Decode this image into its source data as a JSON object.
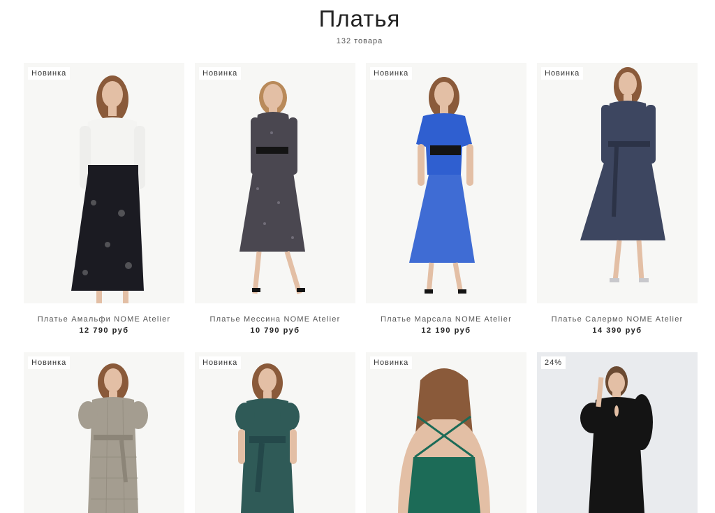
{
  "header": {
    "title": "Платья",
    "count": "132 товара"
  },
  "products": [
    {
      "badge": "Новинка",
      "name": "Платье Амальфи NOME Atelier",
      "price": "12 790 руб",
      "photo": "dress-photo-white-black-lace"
    },
    {
      "badge": "Новинка",
      "name": "Платье Мессина NOME Atelier",
      "price": "10 790 руб",
      "photo": "dress-photo-sequin-black"
    },
    {
      "badge": "Новинка",
      "name": "Платье Марсала NOME Atelier",
      "price": "12 190 руб",
      "photo": "dress-photo-blue-chiffon"
    },
    {
      "badge": "Новинка",
      "name": "Платье Салермо NOME Atelier",
      "price": "14 390 руб",
      "photo": "dress-photo-navy-lurex"
    },
    {
      "badge": "Новинка",
      "photo": "dress-photo-grey-check"
    },
    {
      "badge": "Новинка",
      "photo": "dress-photo-teal-velvet"
    },
    {
      "badge": "Новинка",
      "photo": "dress-photo-green-slip-back"
    },
    {
      "badge": "24%",
      "photo": "dress-photo-black-keyhole"
    }
  ],
  "colors": {
    "white_dress": "#f4f4f2",
    "black_lace": "#1b1b22",
    "sequin": "#4a4750",
    "blue": "#2f5fd0",
    "navy": "#3d4660",
    "grey_check": "#a49d90",
    "teal_velvet": "#2f5a57",
    "green_slip": "#1c6b57",
    "black": "#141414",
    "hair": "#8a5a3a",
    "skin": "#e3bfa5"
  }
}
